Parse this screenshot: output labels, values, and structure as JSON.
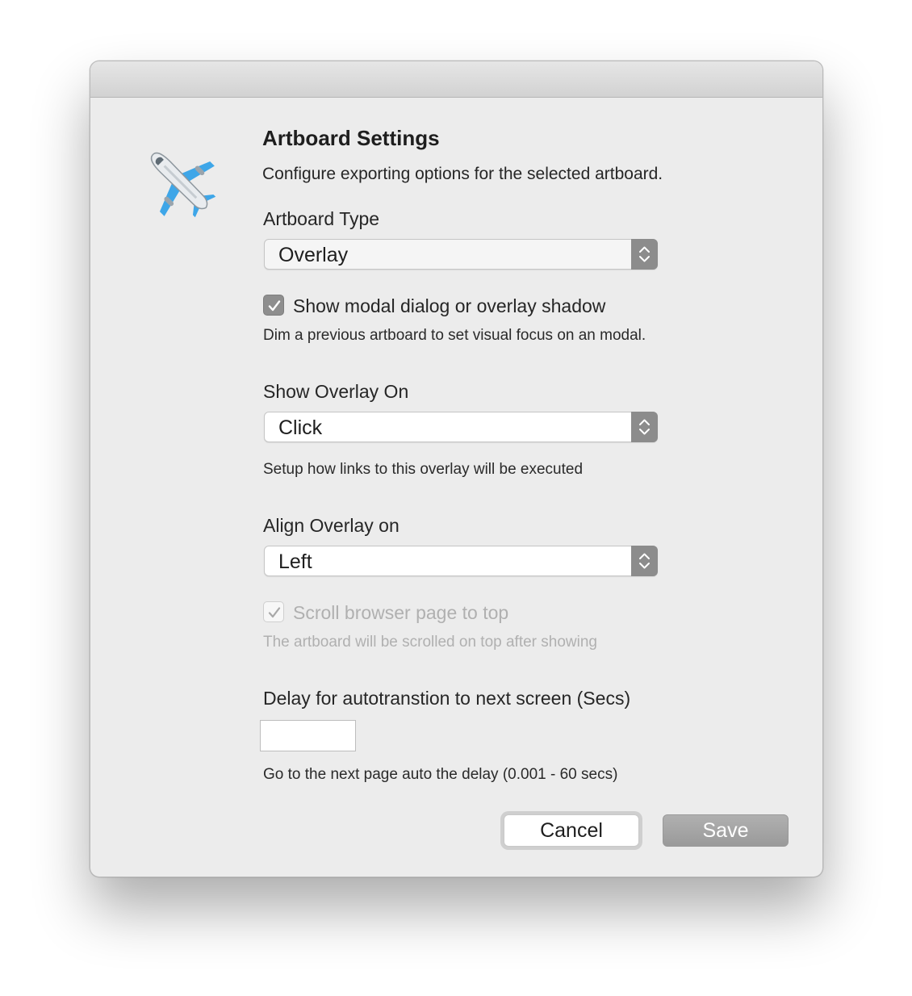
{
  "dialog": {
    "title": "Artboard Settings",
    "description": "Configure exporting options for the selected artboard.",
    "icon": "airplane-icon"
  },
  "artboard_type": {
    "label": "Artboard Type",
    "value": "Overlay"
  },
  "shadow_option": {
    "label": "Show modal dialog or overlay shadow",
    "checked": true,
    "hint": "Dim a previous artboard to set visual focus on an modal."
  },
  "show_overlay_on": {
    "label": "Show Overlay On",
    "value": "Click",
    "hint": "Setup how links to this overlay will be executed"
  },
  "align_overlay": {
    "label": "Align Overlay on",
    "value": "Left"
  },
  "scroll_option": {
    "label": "Scroll browser page to top",
    "checked": true,
    "disabled": true,
    "hint": "The artboard will be scrolled on top after showing"
  },
  "delay": {
    "label": "Delay for autotranstion to next screen (Secs)",
    "value": "",
    "hint": "Go to the next page auto the delay (0.001 - 60 secs)"
  },
  "buttons": {
    "cancel": "Cancel",
    "save": "Save"
  },
  "colors": {
    "window_bg": "#ececec",
    "accent_gray": "#8e8e8e",
    "airplane_blue": "#3ea6e8"
  }
}
